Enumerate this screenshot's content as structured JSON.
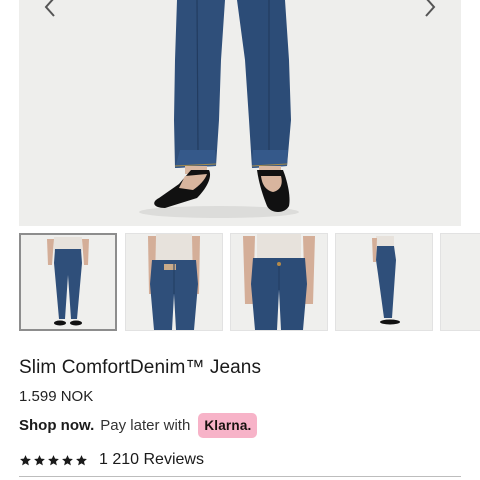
{
  "product": {
    "title": "Slim ComfortDenim™ Jeans",
    "price": "1.599 NOK",
    "shop_now": "Shop now.",
    "pay_later": "Pay later with",
    "klarna": "Klarna.",
    "rating": 5,
    "reviews": "1 210 Reviews"
  },
  "gallery": {
    "thumbnail_count": 5,
    "active_index": 0
  },
  "colors": {
    "klarna_pink": "#f7b3c8",
    "denim": "#2f4f7a",
    "background": "#eeeeec"
  }
}
